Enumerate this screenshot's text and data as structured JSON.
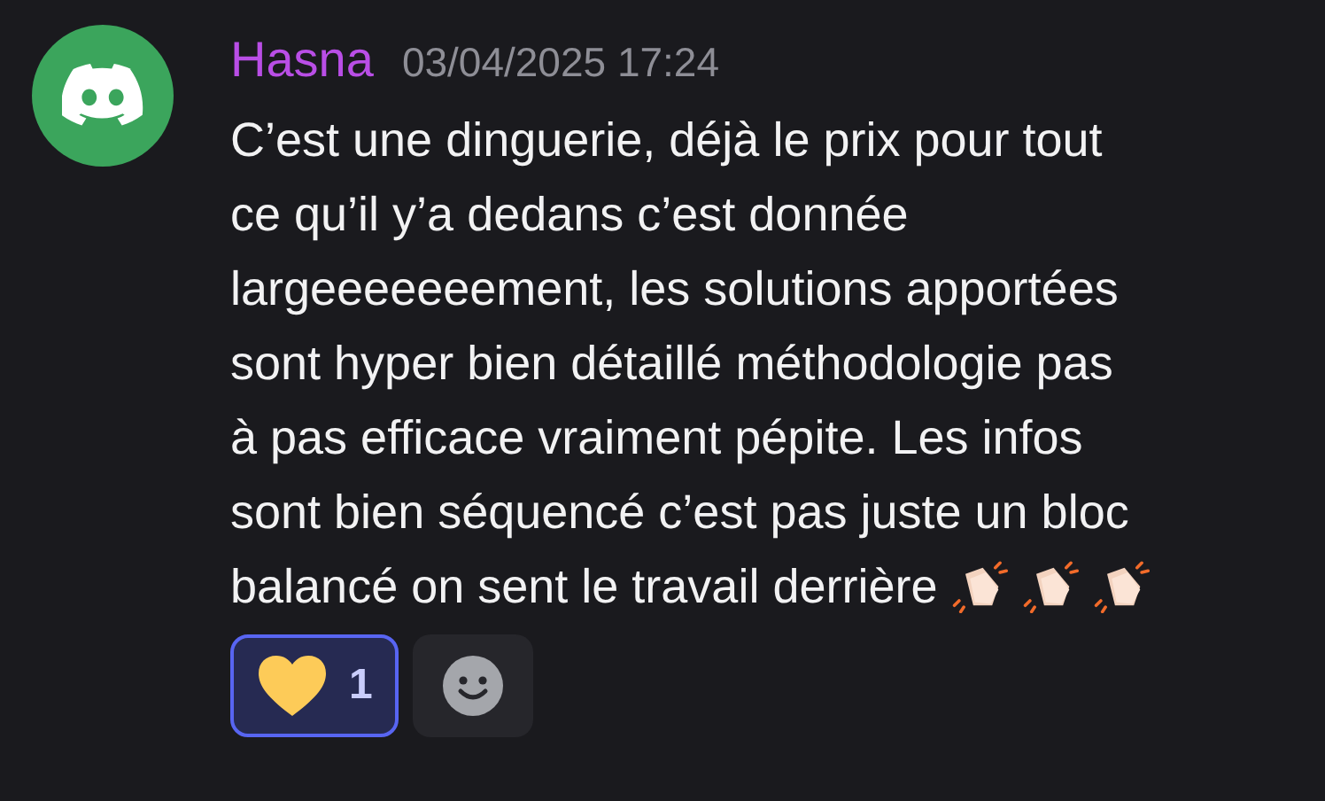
{
  "message": {
    "author": "Hasna",
    "timestamp": "03/04/2025 17:24",
    "text_lines": [
      "C’est une dinguerie, déjà le prix pour tout",
      "ce qu’il y’a dedans c’est donnée",
      "largeeeeeeement, les solutions apportées",
      "sont hyper bien détaillé méthodologie pas",
      "à pas efficace vraiment pépite. Les infos",
      "sont bien séquencé c’est pas juste un bloc",
      "balancé on sent le travail derrière"
    ],
    "trailing_emojis": [
      {
        "kind": "clapping_hands"
      },
      {
        "kind": "clapping_hands"
      },
      {
        "kind": "clapping_hands"
      }
    ]
  },
  "reactions": [
    {
      "count": "1",
      "selected": true
    }
  ]
}
